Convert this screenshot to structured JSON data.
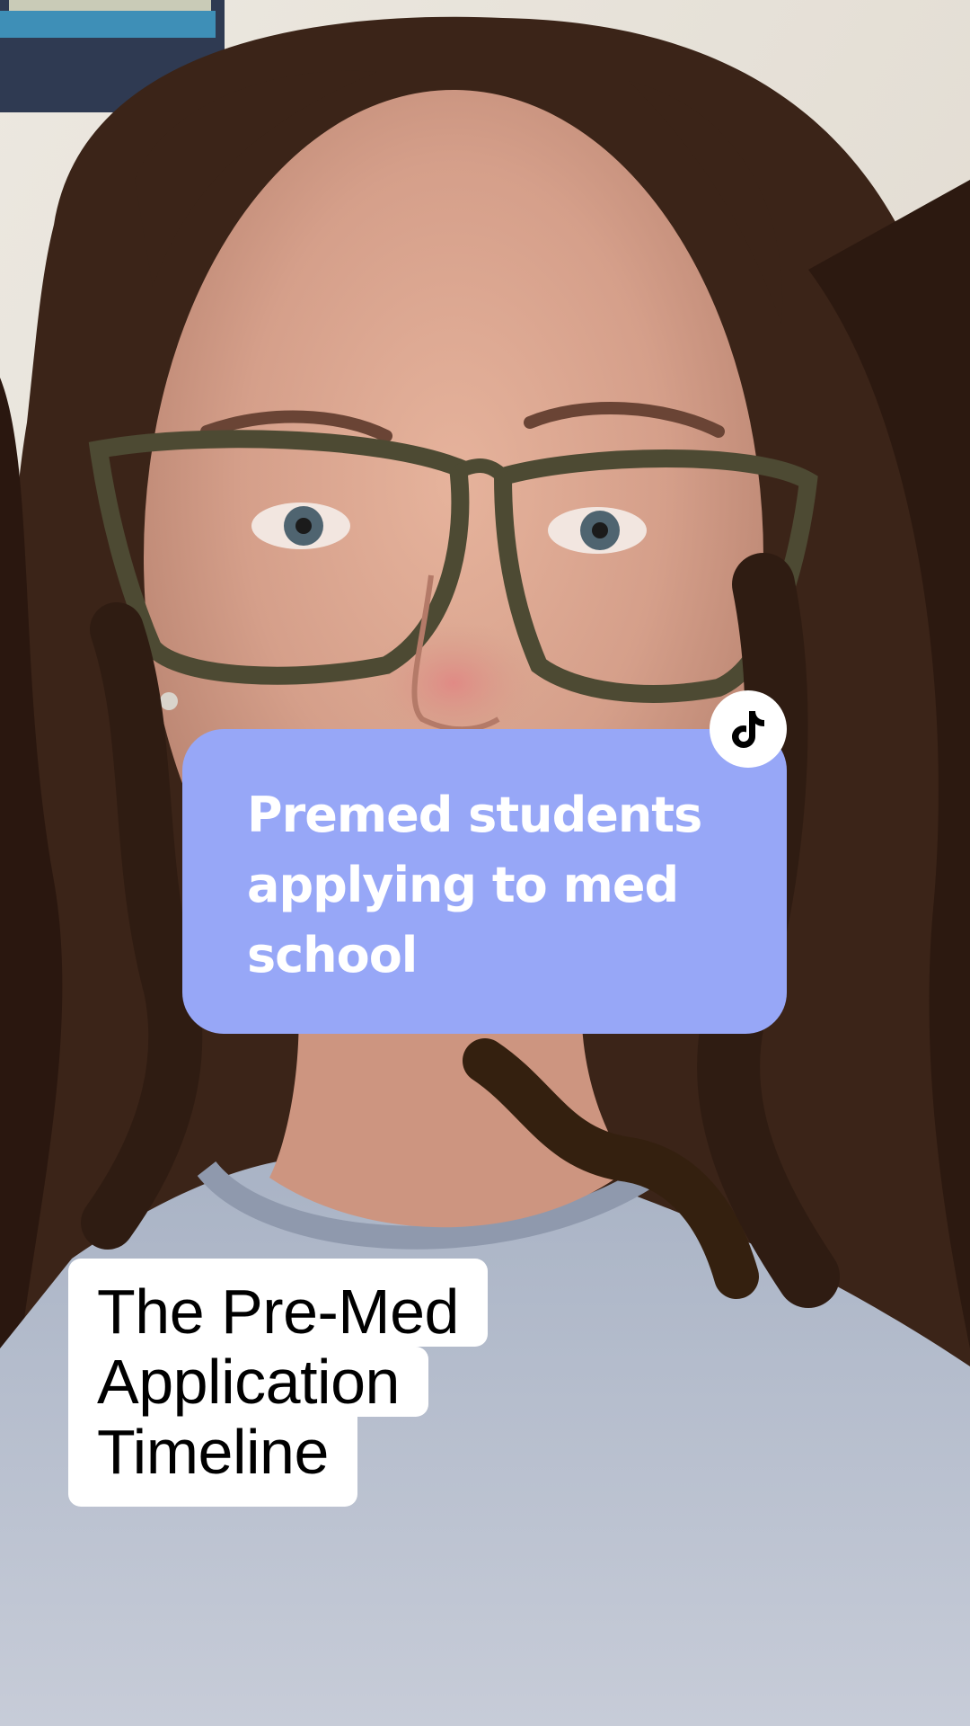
{
  "question_bubble": {
    "text": "Premed students\napplying to med\nschool",
    "background_color": "#97a7f7",
    "text_color": "#ffffff"
  },
  "badge_icon": "tiktok-note-icon",
  "caption": {
    "lines": [
      "The Pre-Med",
      "Application",
      "Timeline"
    ],
    "background_color": "#ffffff",
    "text_color": "#000000"
  },
  "video_description": "selfie video frame of a woman with curly brown hair and glasses"
}
